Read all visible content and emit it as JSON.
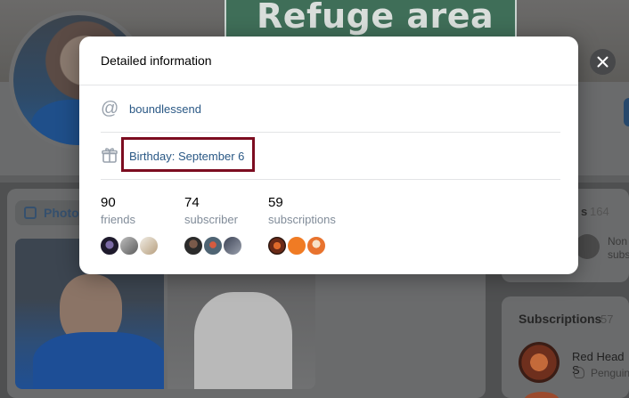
{
  "background": {
    "cover_sign_text": "Refuge area",
    "photos_tab_label": "Photo",
    "side_block_label_fragment": "s",
    "side_block_count": "164",
    "side_block_text_line1": "Non",
    "side_block_text_line2": "subs",
    "subscriptions_title": "Subscriptions",
    "subscriptions_count": "57",
    "subscription_name": "Red Head S",
    "subscription_desc": "Penguin"
  },
  "modal": {
    "title": "Detailed information",
    "username": "boundlessend",
    "birthday_label": "Birthday:",
    "birthday_value": "September 6",
    "stats": [
      {
        "number": "90",
        "label": "friends"
      },
      {
        "number": "74",
        "label": "subscriber"
      },
      {
        "number": "59",
        "label": "subscriptions"
      }
    ]
  },
  "icons": {
    "at": "at-sign-icon",
    "gift": "gift-icon",
    "close": "close-icon"
  },
  "colors": {
    "link": "#2a5885",
    "highlight_border": "#7c0c20",
    "muted": "#818c99"
  }
}
